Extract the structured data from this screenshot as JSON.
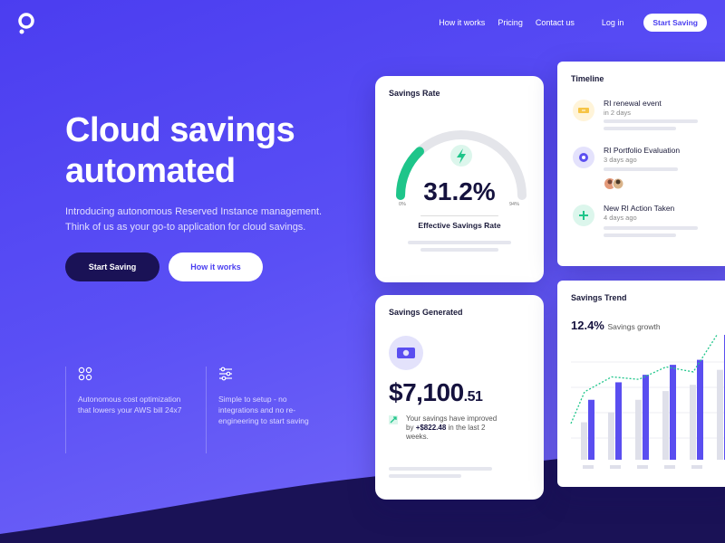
{
  "nav": {
    "links": [
      "How it works",
      "Pricing",
      "Contact us"
    ],
    "login": "Log in",
    "start": "Start Saving"
  },
  "hero": {
    "title": "Cloud savings automated",
    "subtitle": "Introducing autonomous Reserved Instance management. Think of us as your go-to application for cloud savings.",
    "primary_button": "Start Saving",
    "secondary_button": "How it works"
  },
  "features": [
    {
      "icon": "apps-icon",
      "text": "Autonomous cost optimization that lowers your AWS bill 24x7"
    },
    {
      "icon": "sliders-icon",
      "text": "Simple to setup - no integrations and no re-engineering to start saving"
    }
  ],
  "savings_rate": {
    "title": "Savings Rate",
    "value": "31.2%",
    "fraction": 0.312,
    "min_label": "0%",
    "max_label": "94%",
    "label": "Effective Savings Rate",
    "accent": "#1ec58a"
  },
  "timeline": {
    "title": "Timeline",
    "items": [
      {
        "title": "RI renewal event",
        "sub": "in 2 days",
        "icon": "ticket-icon",
        "color": "#f6c445",
        "bg": "#fff4d9"
      },
      {
        "title": "RI Portfolio Evaluation",
        "sub": "3 days ago",
        "icon": "target-icon",
        "color": "#5c50f0",
        "bg": "#e4e2fc"
      },
      {
        "title": "New RI Action Taken",
        "sub": "4 days ago",
        "icon": "plus-icon",
        "color": "#1ec58a",
        "bg": "#dcf6ec"
      }
    ]
  },
  "savings_generated": {
    "title": "Savings Generated",
    "dollars": "$7,100",
    "cents": ".51",
    "note_pre": "Your savings have improved by",
    "note_amount": "+$822.48",
    "note_post": "in the last 2 weeks."
  },
  "savings_trend": {
    "title": "Savings Trend",
    "percent": "12.4%",
    "percent_label": "Savings growth"
  },
  "chart_data": {
    "type": "bar",
    "series": [
      {
        "values": [
          30,
          38,
          48,
          55,
          60,
          72
        ]
      },
      {
        "values": [
          48,
          62,
          68,
          76,
          80,
          100
        ]
      }
    ],
    "trend_line": [
      50,
      62,
      60,
      70,
      66,
      100
    ],
    "categories_count": 6,
    "colors": [
      "#dfe0ea",
      "#5a4ef0",
      "#1ec58a"
    ]
  }
}
